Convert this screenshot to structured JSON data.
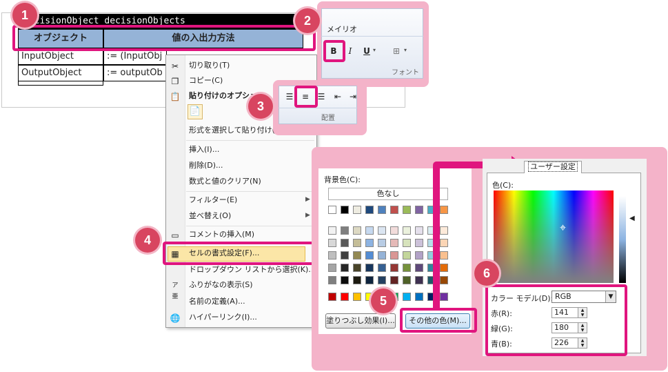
{
  "sheet": {
    "title_row": "decisionObject decisionObjects",
    "col1_header": "オブジェクト",
    "col2_header": "値の入出力方法",
    "rows": [
      {
        "c1": "InputObject",
        "c2": ":= (InputObj"
      },
      {
        "c1": "OutputObject",
        "c2": ":= outputOb"
      }
    ]
  },
  "context_menu": {
    "items": [
      {
        "label": "切り取り(T)",
        "icon": "scissors-icon"
      },
      {
        "label": "コピー(C)",
        "icon": "copy-icon"
      },
      {
        "label": "貼り付けのオプション:",
        "icon": "paste-icon"
      },
      {
        "label": "",
        "icon": "paste-option-icon"
      },
      {
        "label": "形式を選択して貼り付け(S)...",
        "icon": ""
      },
      {
        "label": "挿入(I)...",
        "icon": ""
      },
      {
        "label": "削除(D)...",
        "icon": ""
      },
      {
        "label": "数式と値のクリア(N)",
        "icon": ""
      },
      {
        "label": "フィルター(E)",
        "icon": "",
        "submenu": true
      },
      {
        "label": "並べ替え(O)",
        "icon": "",
        "submenu": true
      },
      {
        "label": "コメントの挿入(M)",
        "icon": "comment-icon"
      },
      {
        "label": "セルの書式設定(F)...",
        "icon": "format-cells-icon"
      },
      {
        "label": "ドロップダウン リストから選択(K)...",
        "icon": ""
      },
      {
        "label": "ふりがなの表示(S)",
        "icon": "furigana-icon"
      },
      {
        "label": "名前の定義(A)...",
        "icon": ""
      },
      {
        "label": "ハイパーリンク(I)...",
        "icon": "hyperlink-icon"
      }
    ]
  },
  "ribbon_font": {
    "font_name": "メイリオ",
    "bold": "B",
    "italic": "I",
    "underline": "U",
    "group_label": "フォント"
  },
  "ribbon_align": {
    "group_label": "配置"
  },
  "color_dialog": {
    "bg_label": "背景色(C):",
    "no_color": "色なし",
    "fill_effects": "塗りつぶし効果(I)...",
    "more_colors": "その他の色(M)...",
    "palette_theme_top": [
      "#ffffff",
      "#000000",
      "#eeece1",
      "#1f497d",
      "#4f81bd",
      "#c0504d",
      "#9bbb59",
      "#8064a2",
      "#4bacc6",
      "#f79646"
    ],
    "palette_shades": [
      [
        "#f2f2f2",
        "#7f7f7f",
        "#ddd9c3",
        "#c6d9f0",
        "#dbe5f1",
        "#f2dcdb",
        "#ebf1dd",
        "#e5e0ec",
        "#dbeef3",
        "#fdeada"
      ],
      [
        "#d8d8d8",
        "#595959",
        "#c4bd97",
        "#8db3e2",
        "#b8cce4",
        "#e5b9b7",
        "#d7e3bc",
        "#ccc1d9",
        "#b7dde8",
        "#fbd5b5"
      ],
      [
        "#bfbfbf",
        "#3f3f3f",
        "#938953",
        "#548dd4",
        "#95b3d7",
        "#d99694",
        "#c3d69b",
        "#b2a2c7",
        "#92cddc",
        "#fac08f"
      ],
      [
        "#a5a5a5",
        "#262626",
        "#494429",
        "#17365d",
        "#366092",
        "#953734",
        "#76923c",
        "#5f497a",
        "#31859b",
        "#e36c09"
      ],
      [
        "#7f7f7f",
        "#0c0c0c",
        "#1d1b10",
        "#0f243e",
        "#244061",
        "#632423",
        "#4f6128",
        "#3f3151",
        "#205867",
        "#974806"
      ]
    ],
    "palette_standard": [
      "#c00000",
      "#ff0000",
      "#ffc000",
      "#ffff00",
      "#92d050",
      "#00b050",
      "#00b0f0",
      "#0070c0",
      "#002060",
      "#7030a0"
    ]
  },
  "custom_colors": {
    "tab_label": "ユーザー設定",
    "color_label": "色(C):",
    "model_label": "カラー モデル(D):",
    "model_value": "RGB",
    "red_label": "赤(R):",
    "green_label": "緑(G):",
    "blue_label": "青(B):",
    "red_value": "141",
    "green_value": "180",
    "blue_value": "226"
  },
  "callouts": [
    "1",
    "2",
    "3",
    "4",
    "5",
    "6"
  ],
  "colors": {
    "accent_pink": "#e0157e",
    "callout_circle": "#d84560",
    "panel_pink": "#f4b3c9",
    "header_blue": "#95b3d7"
  }
}
